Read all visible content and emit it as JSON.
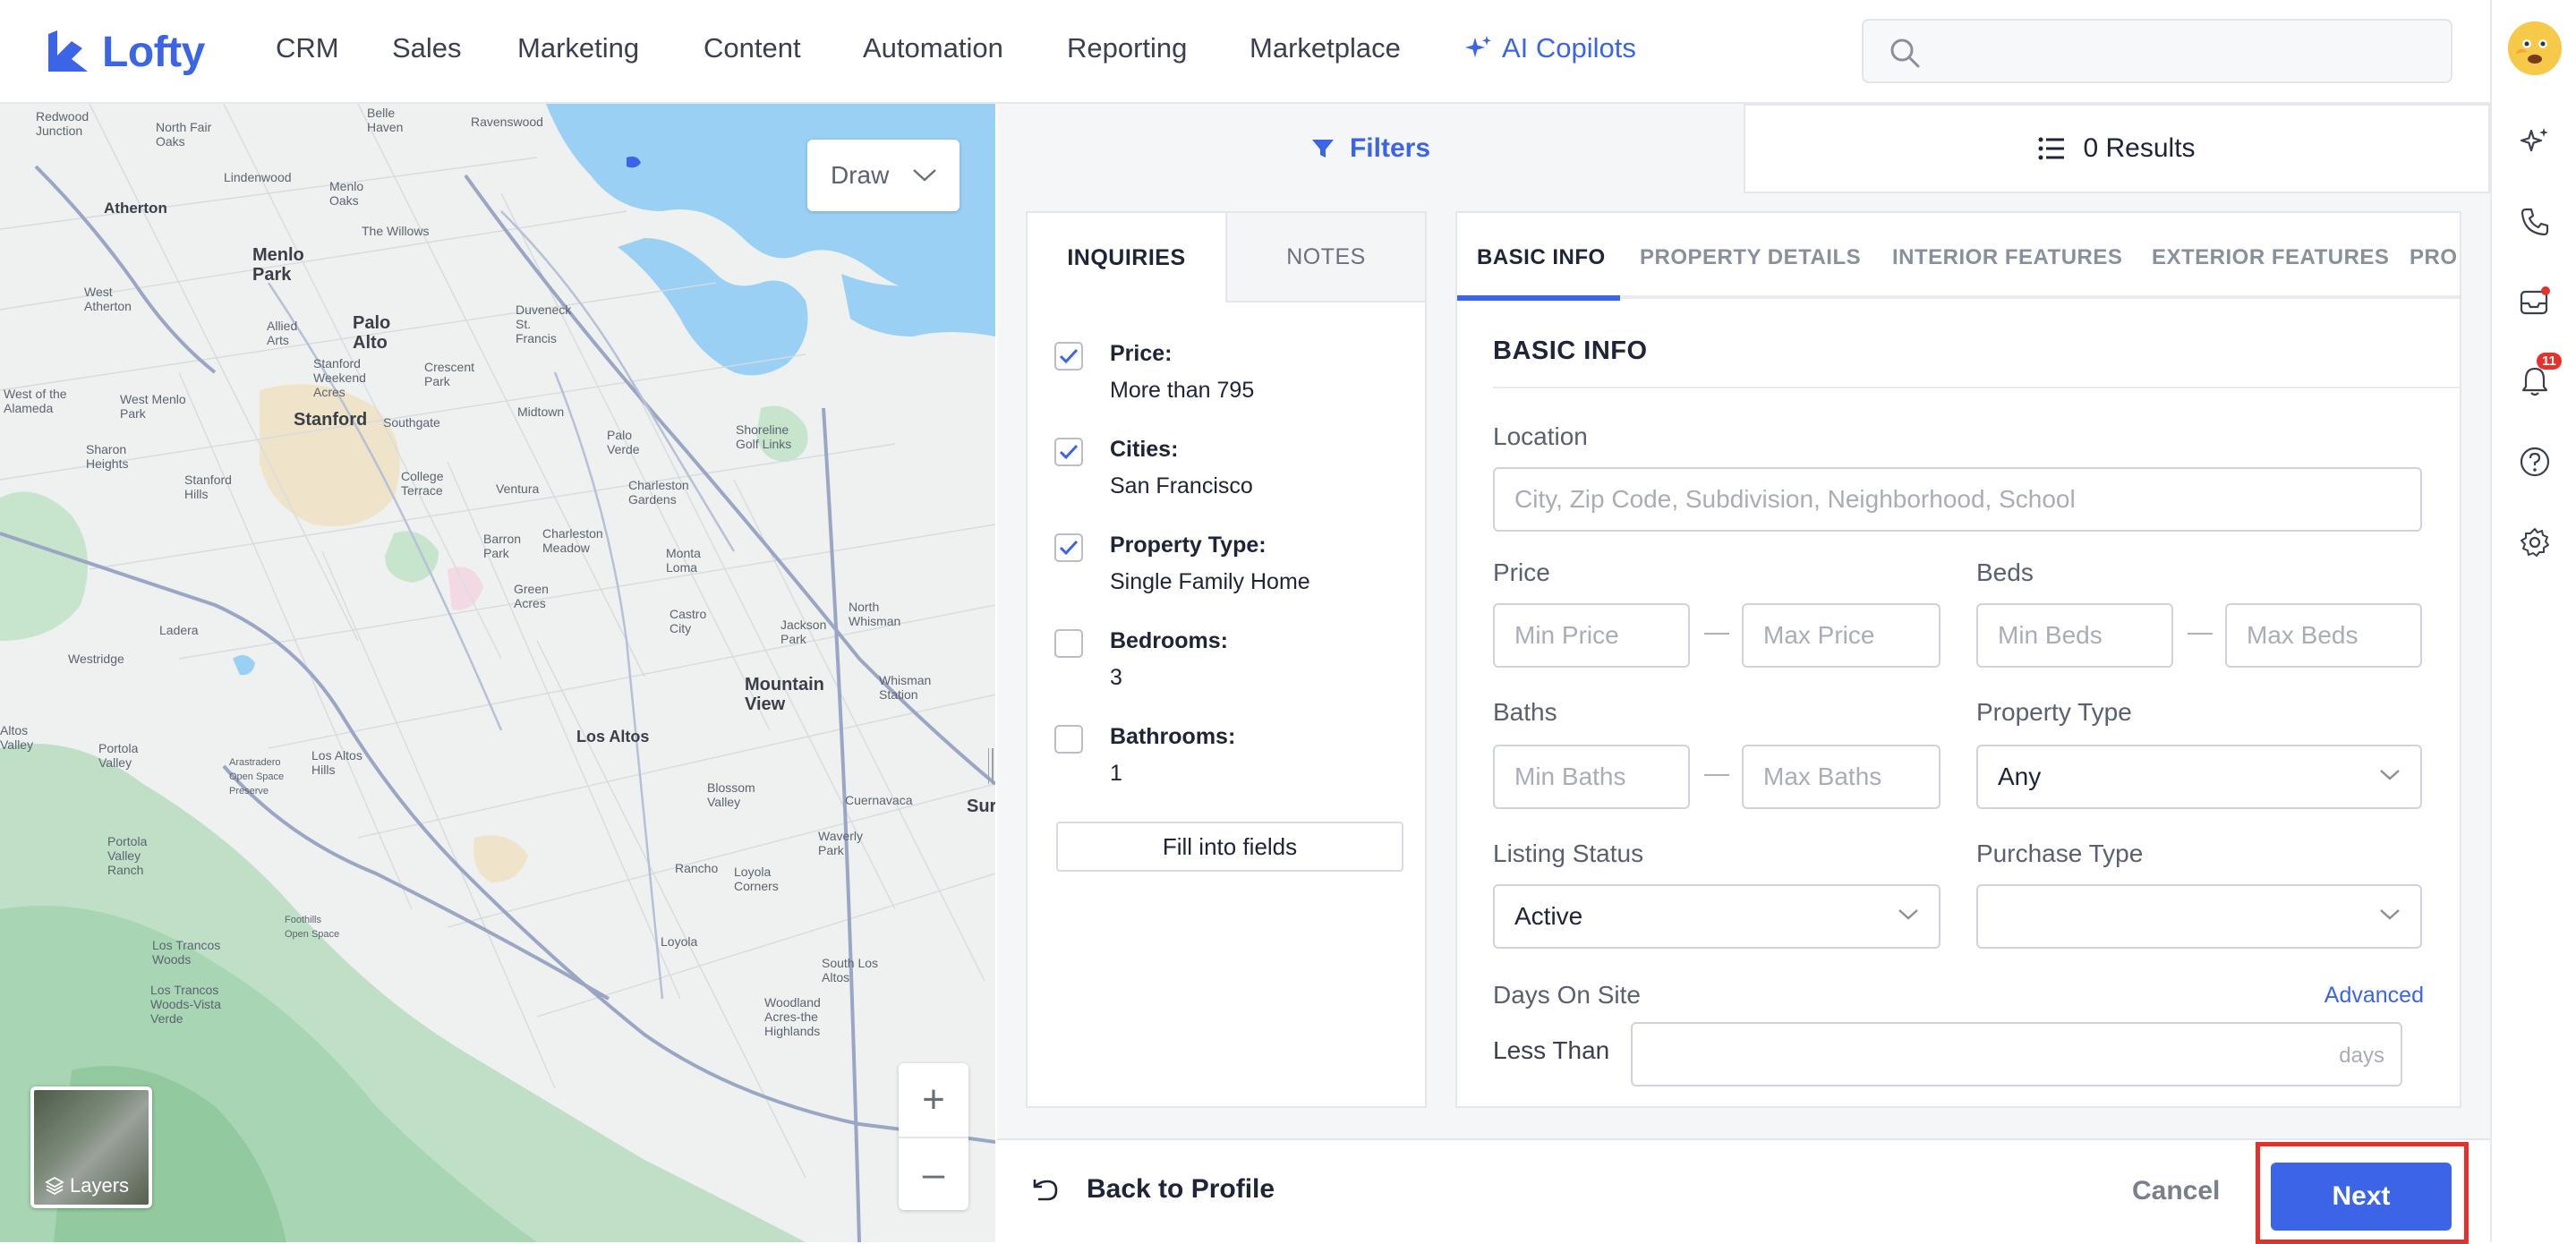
{
  "app": {
    "brand": "Lofty"
  },
  "nav": {
    "items": [
      "CRM",
      "Sales",
      "Marketing",
      "Content",
      "Automation",
      "Reporting",
      "Marketplace"
    ],
    "ai_label": "AI Copilots"
  },
  "search": {
    "placeholder": ""
  },
  "rail": {
    "notifications_count": "11"
  },
  "map": {
    "draw_label": "Draw",
    "zoom_in": "+",
    "zoom_out": "–",
    "layers_label": "Layers",
    "labels": {
      "redwood_junction": "Redwood\nJunction",
      "belle_haven": "Belle\nHaven",
      "ravenswood": "Ravenswood",
      "north_fair_oaks": "North Fair\nOaks",
      "lindenwood": "Lindenwood",
      "menlo_oaks": "Menlo\nOaks",
      "atherton": "Atherton",
      "the_willows": "The Willows",
      "menlo_park": "Menlo\nPark",
      "west_atherton": "West\nAtherton",
      "allied_arts": "Allied\nArts",
      "palo_alto": "Palo\nAlto",
      "duveneck": "Duveneck\nSt.\nFrancis",
      "west_of_alameda": "West of the\nAlameda",
      "west_menlo_park": "West Menlo\nPark",
      "stanford_area": "Stanford\nWeekend\nAcres",
      "crescent_park": "Crescent\nPark",
      "stanford": "Stanford",
      "southgate": "Southgate",
      "midtown": "Midtown",
      "palo_verde": "Palo\nVerde",
      "shoreline": "Shoreline\nGolf Links",
      "sharon_heights": "Sharon\nHeights",
      "stanford_hills": "Stanford\nHills",
      "college_terrace": "College\nTerrace",
      "ventura": "Ventura",
      "charleston_gardens": "Charleston\nGardens",
      "barron_park": "Barron\nPark",
      "charleston_meadow": "Charleston\nMeadow",
      "monta_loma": "Monta\nLoma",
      "green_acres": "Green\nAcres",
      "castro_city": "Castro\nCity",
      "jackson_park": "Jackson\nPark",
      "north_whisman": "North\nWhisman",
      "ladera": "Ladera",
      "westridge": "Westridge",
      "mountain_view": "Mountain\nView",
      "whisman_station": "Whisman\nStation",
      "los_altos": "Los Altos",
      "loyola": "Loyola",
      "altos_valley": "Altos\nValley",
      "los_altos_hills": "Los Altos\nHills",
      "blossom_valley": "Blossom\nValley",
      "cuernavaca": "Cuernavaca",
      "portola_valley": "Portola\nValley",
      "waverly_park": "Waverly\nPark",
      "portola_valley_ranch": "Portola\nValley\nRanch",
      "rancho": "Rancho",
      "loyola_corners": "Loyola\nCorners",
      "los_trancos_woods": "Los Trancos\nWoods",
      "los_trancos_vista": "Los Trancos\nWoods-Vista\nVerde",
      "south_los_altos": "South Los\nAltos",
      "woodland_acres": "Woodland\nAcres-the\nHighlands",
      "sur": "Sur",
      "arastradero": "Arastradero\nOpen Space\nPreserve",
      "foothills": "Foothills\nOpen Space"
    }
  },
  "panel": {
    "filters_label": "Filters",
    "results_label": "0 Results"
  },
  "inquiries": {
    "tab_inquiries": "INQUIRIES",
    "tab_notes": "NOTES",
    "items": [
      {
        "label": "Price:",
        "value": "More than 795",
        "checked": true
      },
      {
        "label": "Cities:",
        "value": "San Francisco",
        "checked": true
      },
      {
        "label": "Property Type:",
        "value": "Single Family Home",
        "checked": true
      },
      {
        "label": "Bedrooms:",
        "value": "3",
        "checked": false
      },
      {
        "label": "Bathrooms:",
        "value": "1",
        "checked": false
      }
    ],
    "fill_button": "Fill into fields"
  },
  "form": {
    "tabs": [
      "BASIC INFO",
      "PROPERTY DETAILS",
      "INTERIOR FEATURES",
      "EXTERIOR FEATURES",
      "PRO"
    ],
    "section_title": "BASIC INFO",
    "location": {
      "label": "Location",
      "placeholder": "City, Zip Code, Subdivision, Neighborhood, School"
    },
    "price": {
      "label": "Price",
      "min_placeholder": "Min Price",
      "max_placeholder": "Max Price"
    },
    "beds": {
      "label": "Beds",
      "min_placeholder": "Min Beds",
      "max_placeholder": "Max Beds"
    },
    "baths": {
      "label": "Baths",
      "min_placeholder": "Min Baths",
      "max_placeholder": "Max Baths"
    },
    "property_type": {
      "label": "Property Type",
      "value": "Any"
    },
    "listing_status": {
      "label": "Listing Status",
      "value": "Active"
    },
    "purchase_type": {
      "label": "Purchase Type",
      "value": ""
    },
    "days_on_site": {
      "label": "Days On Site",
      "qualifier": "Less Than",
      "unit": "days",
      "advanced": "Advanced"
    },
    "range_sep": "—"
  },
  "footer": {
    "back_label": "Back to Profile",
    "cancel_label": "Cancel",
    "next_label": "Next"
  },
  "colors": {
    "accent": "#3c64e6",
    "highlight": "#e5312b",
    "notification": "#e5312b"
  }
}
